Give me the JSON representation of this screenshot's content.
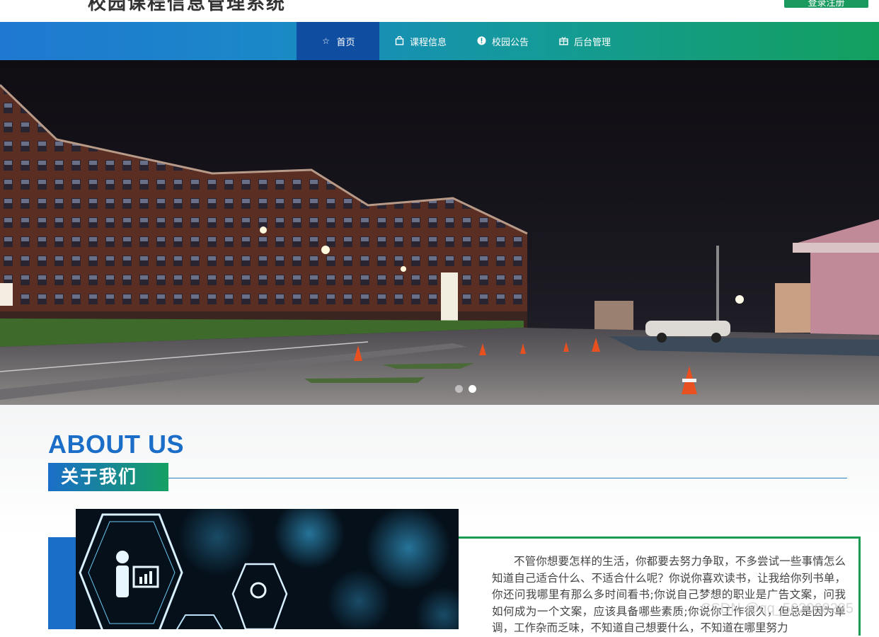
{
  "header": {
    "site_title": "校园课程信息管理系统",
    "login_label": "登录注册"
  },
  "nav": {
    "items": [
      {
        "label": "首页",
        "icon": "star-icon",
        "glyph": "☆",
        "active": true
      },
      {
        "label": "课程信息",
        "icon": "bag-icon",
        "glyph": "⌂",
        "active": false
      },
      {
        "label": "校园公告",
        "icon": "info-icon",
        "glyph": "❗",
        "active": false
      },
      {
        "label": "后台管理",
        "icon": "gift-icon",
        "glyph": "⊞",
        "active": false
      }
    ]
  },
  "hero": {
    "slides": 2,
    "active_slide": 2
  },
  "about": {
    "title_en": "ABOUT US",
    "title_cn": "关于我们",
    "paragraph": "不管你想要怎样的生活，你都要去努力争取，不多尝试一些事情怎么知道自己适合什么、不适合什么呢？你说你喜欢读书，让我给你列书单，你还问我哪里有那么多时间看书;你说自己梦想的职业是广告文案，问我如何成为一个文案，应该具备哪些素质;你说你工作很久，但总是因为单调，工作杂而乏味，不知道自己想要什么，不知道在哪里努力"
  },
  "watermark": "CSDN @qq_562068285",
  "colors": {
    "nav_start": "#1f78d1",
    "nav_end": "#13a05e",
    "nav_active": "#0f4da0",
    "about_blue": "#1a6ec8",
    "about_green": "#1a9a52"
  }
}
